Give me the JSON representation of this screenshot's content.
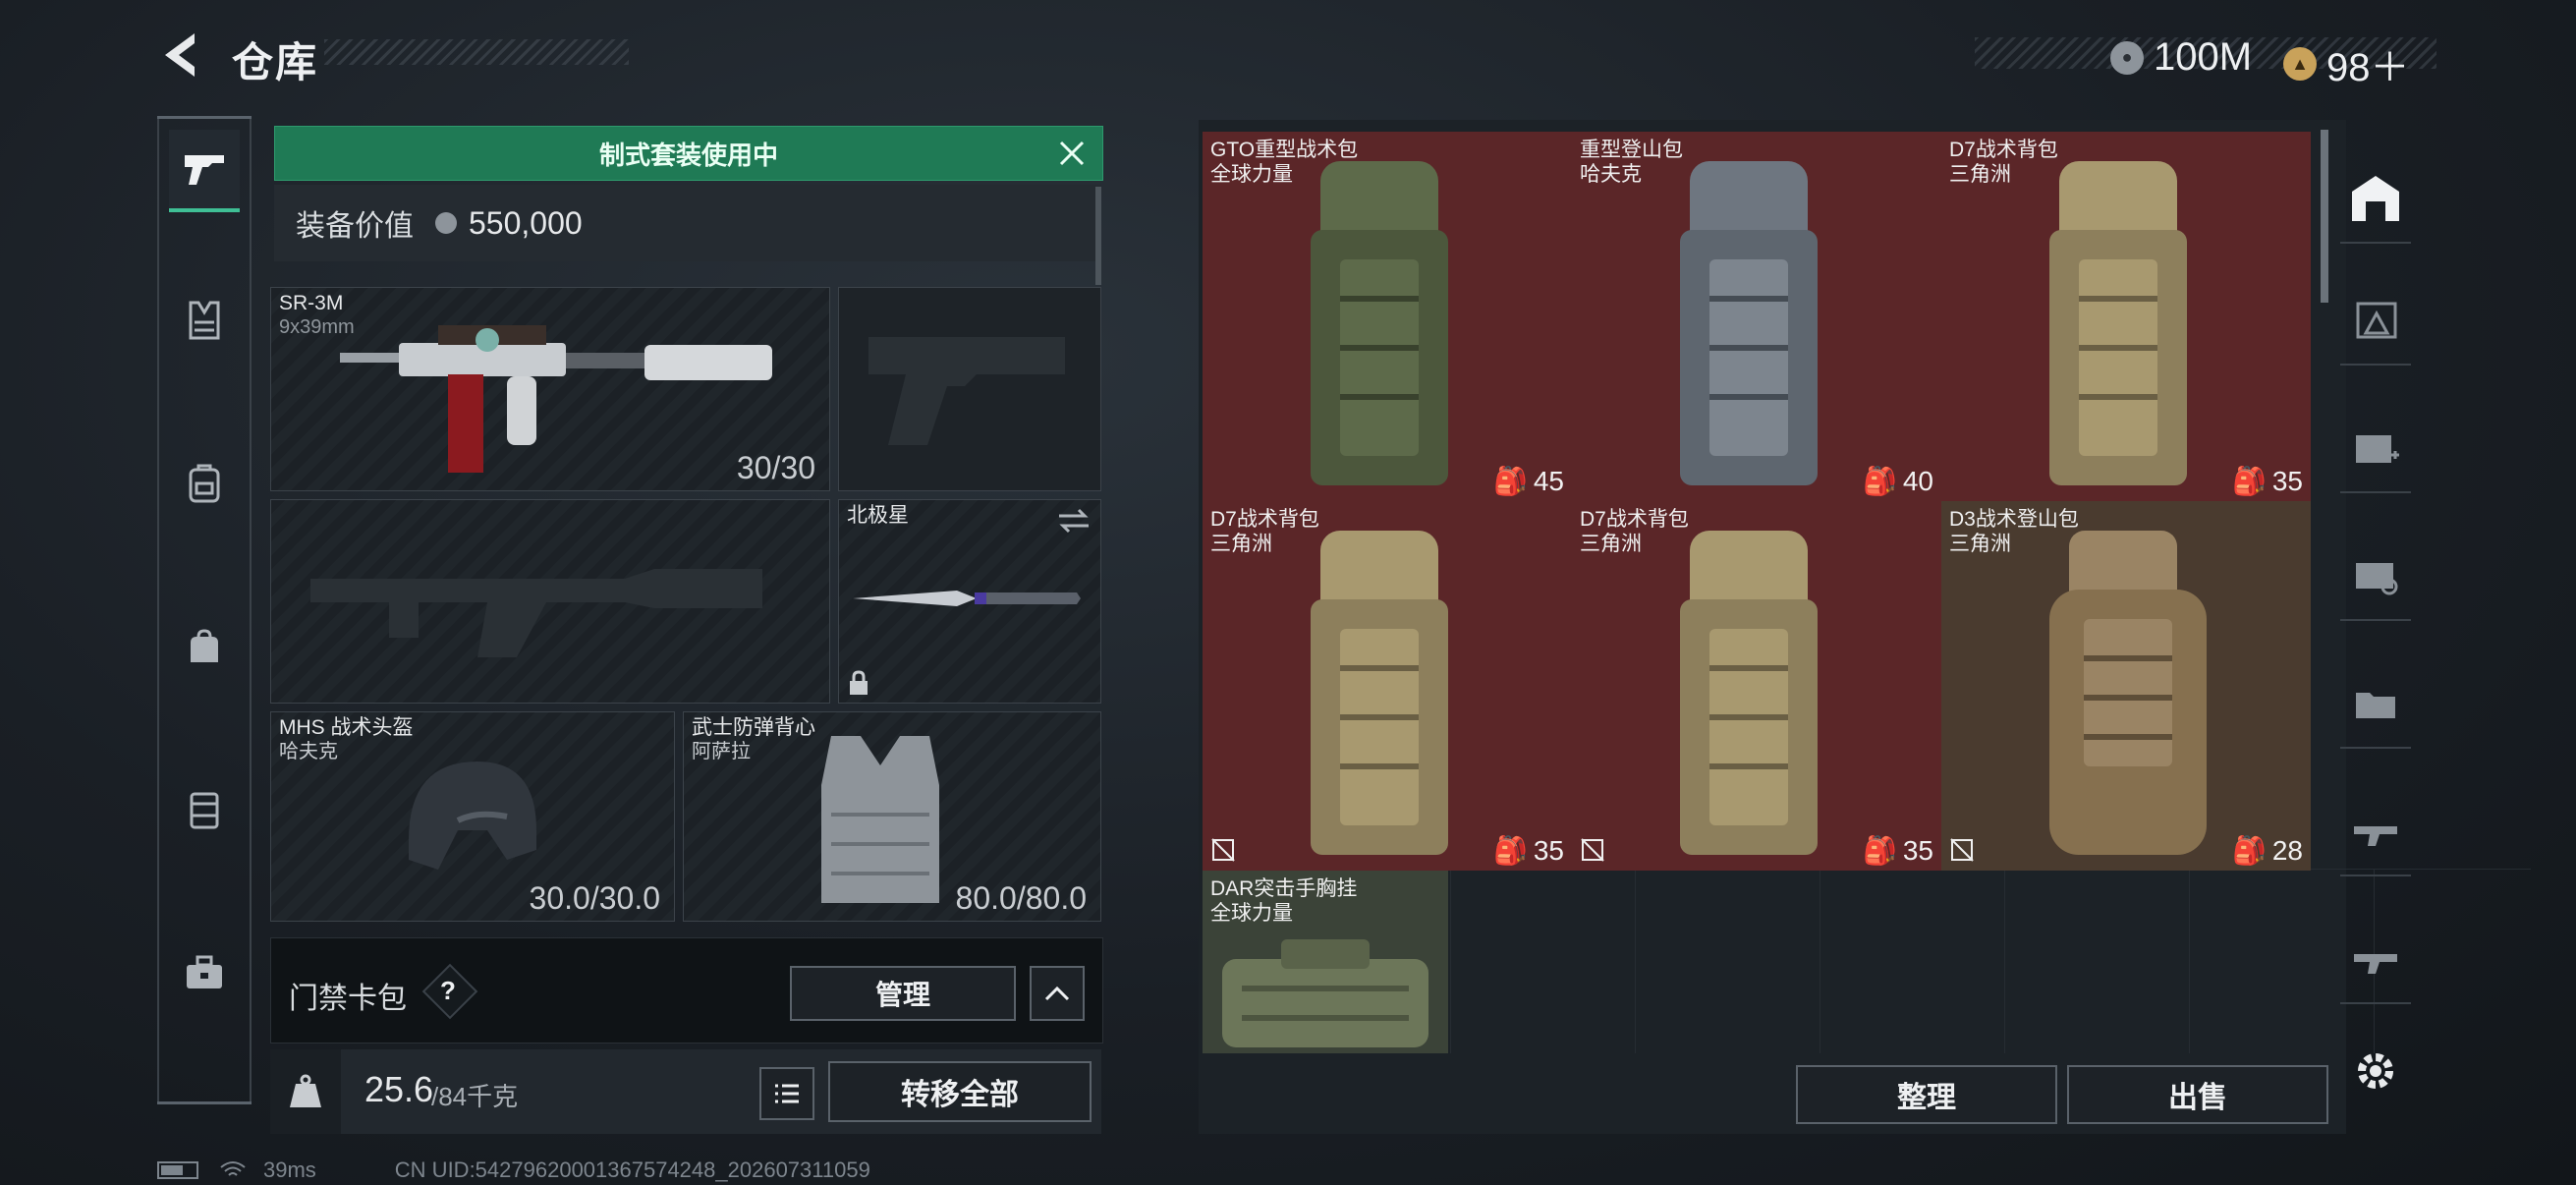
{
  "header": {
    "title": "仓库",
    "currency_silver": "100M",
    "currency_gold": "98＋"
  },
  "nav": {
    "items": [
      "weapon",
      "vest",
      "backpack",
      "bag",
      "container",
      "toolbox"
    ]
  },
  "loadout": {
    "banner": "制式套装使用中",
    "value_label": "装备价值",
    "value": "550,000",
    "primary": {
      "name": "SR-3M",
      "caliber": "9x39mm",
      "ammo": "30/30"
    },
    "melee": {
      "name": "北极星"
    },
    "helmet": {
      "name": "MHS 战术头盔",
      "brand": "哈夫克",
      "durability": "30.0/30.0"
    },
    "armor": {
      "name": "武士防弹背心",
      "brand": "阿萨拉",
      "durability": "80.0/80.0"
    },
    "access_label": "门禁卡包",
    "help": "?",
    "manage_label": "管理",
    "weight_current": "25.6",
    "weight_max": "/84千克",
    "transfer_all": "转移全部"
  },
  "inventory": {
    "items": [
      {
        "name": "GTO重型战术包",
        "brand": "全球力量",
        "capacity": "45",
        "color": "#5b2628",
        "bag_color": "#5d6a4a"
      },
      {
        "name": "重型登山包",
        "brand": "哈夫克",
        "capacity": "40",
        "color": "#5b2628",
        "bag_color": "#6e7680"
      },
      {
        "name": "D7战术背包",
        "brand": "三角洲",
        "capacity": "35",
        "color": "#5b2628",
        "bag_color": "#9a8a64"
      },
      {
        "name": "D7战术背包",
        "brand": "三角洲",
        "capacity": "35",
        "color": "#5b2628",
        "bag_color": "#9a8a64"
      },
      {
        "name": "D7战术背包",
        "brand": "三角洲",
        "capacity": "35",
        "color": "#5b2628",
        "bag_color": "#9a8a64"
      },
      {
        "name": "D3战术登山包",
        "brand": "三角洲",
        "capacity": "28",
        "color": "#4a3b2f",
        "bag_color": "#8a7458"
      }
    ],
    "chest": {
      "name": "DAR突击手胸挂",
      "brand": "全球力量"
    },
    "sort_label": "整理",
    "sell_label": "出售"
  },
  "status": {
    "ping": "39ms",
    "uid": "CN UID:5427962000136757424​8_202607311059"
  }
}
